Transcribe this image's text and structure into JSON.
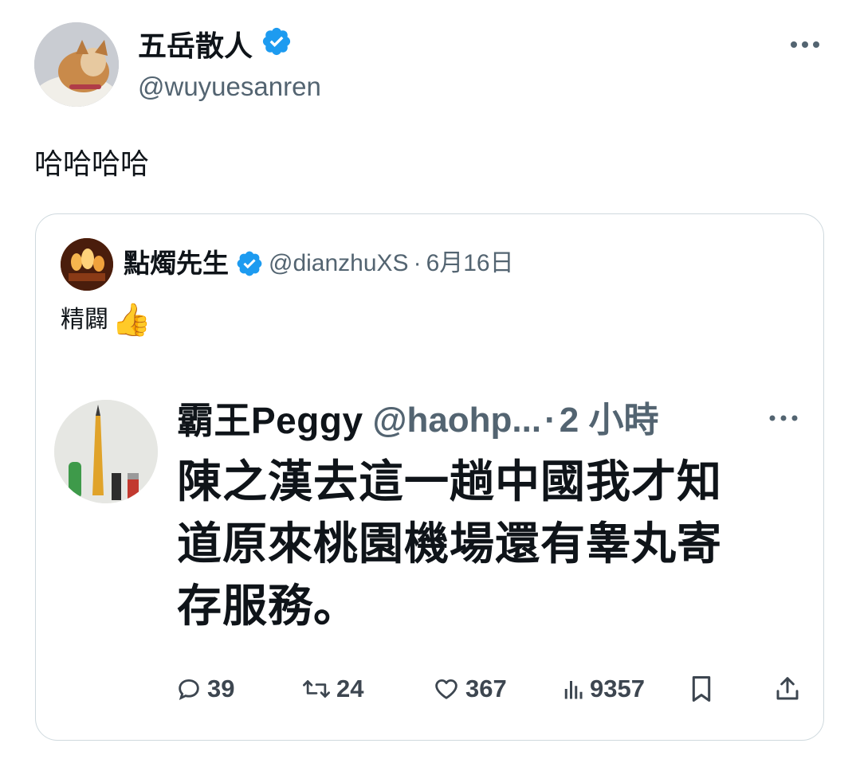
{
  "tweet": {
    "author_name": "五岳散人",
    "author_handle": "@wuyuesanren",
    "text": "哈哈哈哈"
  },
  "quoted": {
    "author_name": "點燭先生",
    "author_handle": "@dianzhuXS",
    "separator": "·",
    "date": "6月16日",
    "text": "精闢",
    "emoji": "👍"
  },
  "embedded_screenshot": {
    "author_name": "霸王Peggy",
    "author_handle": "@haohp...",
    "separator": "·",
    "time": "2 小時",
    "lines": [
      "陳之漢去這一趟中國我才知",
      "道原來桃園機場還有睾丸寄",
      "存服務。"
    ],
    "actions": {
      "replies": "39",
      "retweets": "24",
      "likes": "367",
      "views": "9357"
    }
  },
  "colors": {
    "verified_badge": "#1d9bf0",
    "secondary_text": "#536471",
    "card_border": "#cfd9de",
    "primary_text": "#0f1419"
  },
  "icons": [
    "verified-badge-icon",
    "more-options-icon",
    "reply-icon",
    "retweet-icon",
    "like-icon",
    "views-icon",
    "bookmark-icon",
    "share-icon"
  ]
}
